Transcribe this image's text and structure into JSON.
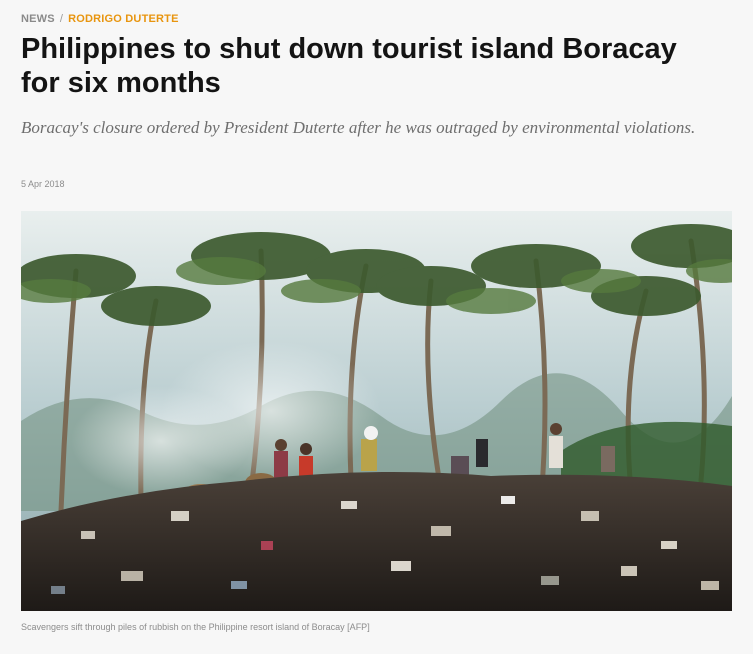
{
  "breadcrumb": {
    "section": "NEWS",
    "separator": "/",
    "topic": "RODRIGO DUTERTE",
    "topic_color": "#e8950f"
  },
  "article": {
    "headline": "Philippines to shut down tourist island Boracay for six months",
    "standfirst": "Boracay's closure ordered by President Duterte after he was outraged by environmental violations.",
    "date": "5 Apr 2018",
    "image_caption": "Scavengers sift through piles of rubbish on the Philippine resort island of Boracay [AFP]"
  }
}
